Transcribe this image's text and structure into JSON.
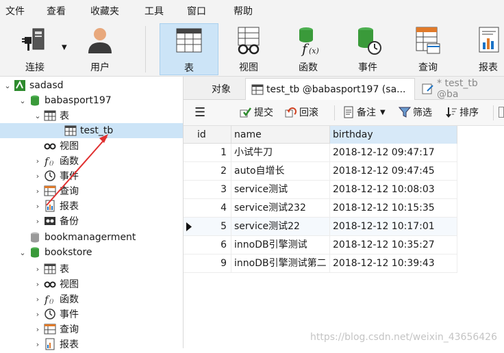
{
  "menu": [
    "文件",
    "查看",
    "收藏夹",
    "工具",
    "窗口",
    "帮助"
  ],
  "toolbar": {
    "connect": "连接",
    "user": "用户",
    "table": "表",
    "view": "视图",
    "function": "函数",
    "event": "事件",
    "query": "查询",
    "report": "报表"
  },
  "tree": {
    "connection": "sadasd",
    "db1": "babasport197",
    "tables": "表",
    "table_item": "test_tb",
    "views": "视图",
    "functions": "函数",
    "events": "事件",
    "queries": "查询",
    "reports": "报表",
    "backups": "备份",
    "db2": "bookmanagerment",
    "db3": "bookstore",
    "db3_tables": "表",
    "db3_views": "视图",
    "db3_functions": "函数",
    "db3_events": "事件",
    "db3_queries": "查询",
    "db3_reports": "报表"
  },
  "tabs": {
    "objects": "对象",
    "active": "test_tb @babasport197 (sa...",
    "other": "* test_tb @ba"
  },
  "actions": {
    "commit": "提交",
    "rollback": "回滚",
    "notes": "备注",
    "filter": "筛选",
    "sort": "排序"
  },
  "grid": {
    "columns": [
      "id",
      "name",
      "birthday"
    ],
    "rows": [
      {
        "id": "1",
        "name": "小试牛刀",
        "birthday": "2018-12-12 09:47:17"
      },
      {
        "id": "2",
        "name": "auto自增长",
        "birthday": "2018-12-12 09:47:45"
      },
      {
        "id": "3",
        "name": "service测试",
        "birthday": "2018-12-12 10:08:03"
      },
      {
        "id": "4",
        "name": "service测试232",
        "birthday": "2018-12-12 10:15:35"
      },
      {
        "id": "5",
        "name": "service测试22",
        "birthday": "2018-12-12 10:17:01"
      },
      {
        "id": "6",
        "name": "innoDB引擎测试",
        "birthday": "2018-12-12 10:35:27"
      },
      {
        "id": "9",
        "name": "innoDB引擎测试第二",
        "birthday": "2018-12-12 10:39:43"
      }
    ]
  },
  "watermark": "https://blog.csdn.net/weixin_43656426",
  "colors": {
    "accent": "#cce4f7",
    "db_green": "#3a9a3a",
    "annotation_red": "#e03030"
  }
}
